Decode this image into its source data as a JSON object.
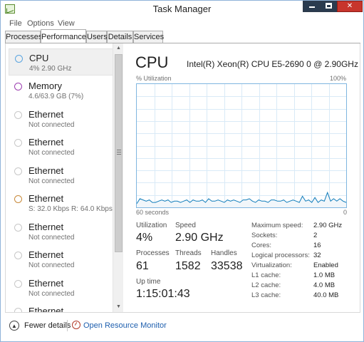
{
  "window": {
    "title": "Task Manager",
    "controls": {
      "minimize": "minimize-icon",
      "maximize": "maximize-icon",
      "close": "close-icon"
    }
  },
  "menu": [
    "File",
    "Options",
    "View"
  ],
  "tabs": [
    {
      "label": "Processes",
      "active": false
    },
    {
      "label": "Performance",
      "active": true
    },
    {
      "label": "Users",
      "active": false
    },
    {
      "label": "Details",
      "active": false
    },
    {
      "label": "Services",
      "active": false
    }
  ],
  "sidebar": {
    "items": [
      {
        "name": "CPU",
        "sub": "4%  2.90 GHz",
        "circle_color": "#5aa5e0",
        "selected": true
      },
      {
        "name": "Memory",
        "sub": "4.6/63.9 GB (7%)",
        "circle_color": "#9d3fb0",
        "selected": false
      },
      {
        "name": "Ethernet",
        "sub": "Not connected",
        "circle_color": "#c8c8c8",
        "selected": false
      },
      {
        "name": "Ethernet",
        "sub": "Not connected",
        "circle_color": "#c8c8c8",
        "selected": false
      },
      {
        "name": "Ethernet",
        "sub": "Not connected",
        "circle_color": "#c8c8c8",
        "selected": false
      },
      {
        "name": "Ethernet",
        "sub": "S: 32.0 Kbps  R: 64.0 Kbps",
        "circle_color": "#c88a3a",
        "selected": false
      },
      {
        "name": "Ethernet",
        "sub": "Not connected",
        "circle_color": "#c8c8c8",
        "selected": false
      },
      {
        "name": "Ethernet",
        "sub": "Not connected",
        "circle_color": "#c8c8c8",
        "selected": false
      },
      {
        "name": "Ethernet",
        "sub": "Not connected",
        "circle_color": "#c8c8c8",
        "selected": false
      },
      {
        "name": "Ethernet",
        "sub": "",
        "circle_color": "#c8c8c8",
        "selected": false
      }
    ]
  },
  "cpu": {
    "title": "CPU",
    "model": "Intel(R) Xeon(R) CPU E5-2690 0 @ 2.90GHz",
    "graph": {
      "y_label": "% Utilization",
      "y_max_label": "100%",
      "x_left_label": "60 seconds",
      "x_right_label": "0",
      "line_color": "#117dbb",
      "fill_color": "#f1f6fa",
      "grid_color": "#d9eaf7",
      "utilization_percent_series": [
        3,
        7,
        6,
        5,
        6,
        4,
        4,
        5,
        6,
        5,
        6,
        4,
        5,
        5,
        4,
        5,
        6,
        4,
        6,
        5,
        5,
        6,
        4,
        7,
        5,
        5,
        6,
        5,
        4,
        6,
        5,
        6,
        5,
        4,
        6,
        6,
        7,
        5,
        4,
        6,
        5,
        5,
        4,
        6,
        6,
        5,
        5,
        6,
        4,
        5,
        6,
        5,
        4,
        9,
        5,
        6,
        4,
        8,
        4,
        6,
        5,
        12,
        5,
        7,
        5,
        7,
        5,
        4
      ]
    },
    "stats": {
      "utilization_label": "Utilization",
      "utilization_value": "4%",
      "speed_label": "Speed",
      "speed_value": "2.90 GHz",
      "processes_label": "Processes",
      "processes_value": "61",
      "threads_label": "Threads",
      "threads_value": "1582",
      "handles_label": "Handles",
      "handles_value": "33538",
      "uptime_label": "Up time",
      "uptime_value": "1:15:01:43"
    },
    "details": [
      {
        "label": "Maximum speed:",
        "value": "2.90 GHz"
      },
      {
        "label": "Sockets:",
        "value": "2"
      },
      {
        "label": "Cores:",
        "value": "16"
      },
      {
        "label": "Logical processors:",
        "value": "32"
      },
      {
        "label": "Virtualization:",
        "value": "Enabled"
      },
      {
        "label": "L1 cache:",
        "value": "1.0 MB"
      },
      {
        "label": "L2 cache:",
        "value": "4.0 MB"
      },
      {
        "label": "L3 cache:",
        "value": "40.0 MB"
      }
    ]
  },
  "footer": {
    "fewer_details": "Fewer details",
    "open_resource_monitor": "Open Resource Monitor"
  }
}
